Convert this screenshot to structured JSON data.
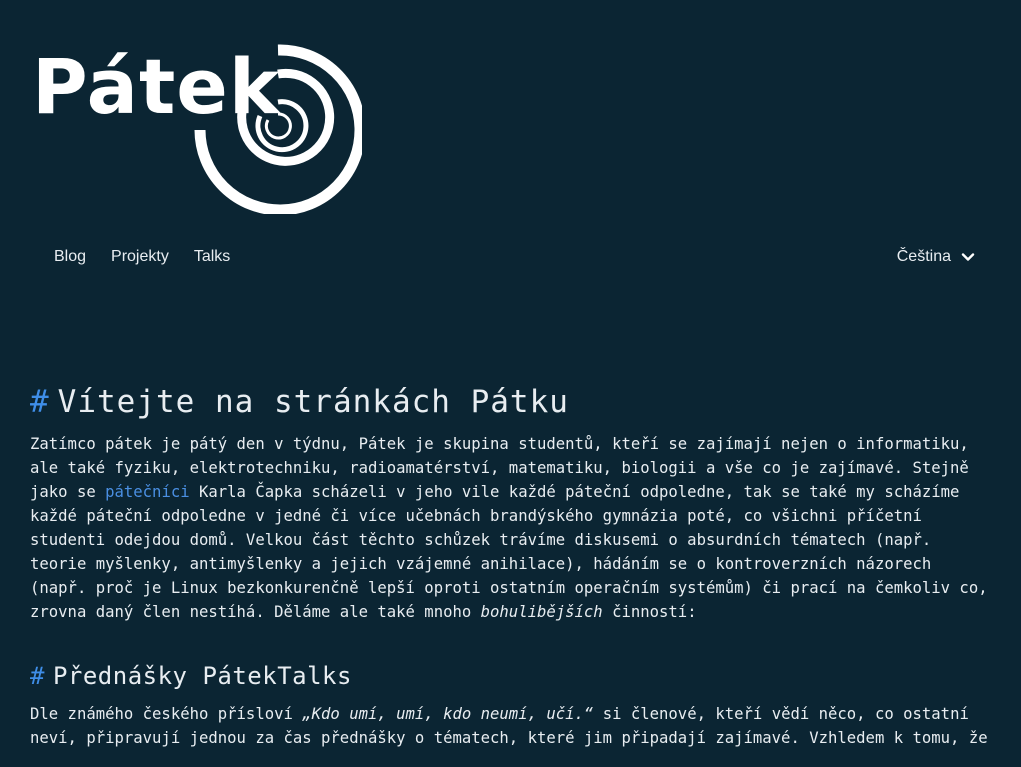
{
  "logo": {
    "text": "Pátek"
  },
  "nav": {
    "items": [
      "Blog",
      "Projekty",
      "Talks"
    ]
  },
  "language": {
    "selected": "Čeština"
  },
  "sections": [
    {
      "hash": "#",
      "title": "Vítejte na stránkách Pátku",
      "paragraph": {
        "t1": "Zatímco pátek je pátý den v týdnu, Pátek je skupina studentů, kteří se zajímají nejen o informatiku, ale také fyziku, elektrotechniku, radioamatérství, matematiku, biologii a vše co je zajímavé. Stejně jako se ",
        "link": "pátečníci",
        "t2": " Karla Čapka scházeli v jeho vile každé páteční odpoledne, tak se také my scházíme každé páteční odpoledne v jedné či více učebnách brandýského gymnázia poté, co všichni příčetní studenti odejdou domů. Velkou část těchto schůzek trávíme diskusemi o absurdních tématech (např. teorie myšlenky, antimyšlenky a jejich vzájemné anihilace), hádáním se o kontroverzních názorech (např. proč je Linux bezkonkurenčně lepší oproti ostatním operačním systémům) či prací na čemkoliv co, zrovna daný člen nestíhá. Děláme ale také mnoho ",
        "em": "bohulibějších",
        "t3": " činností:"
      }
    },
    {
      "hash": "#",
      "title": "Přednášky PátekTalks",
      "paragraph": {
        "t1": "Dle známého českého přísloví ",
        "em": "„Kdo umí, umí, kdo neumí, učí.“",
        "t2": " si členové, kteří vědí něco, co ostatní neví, připravují jednou za čas přednášky o tématech, které jim připadají zajímavé. Vzhledem k tomu, že"
      }
    }
  ]
}
